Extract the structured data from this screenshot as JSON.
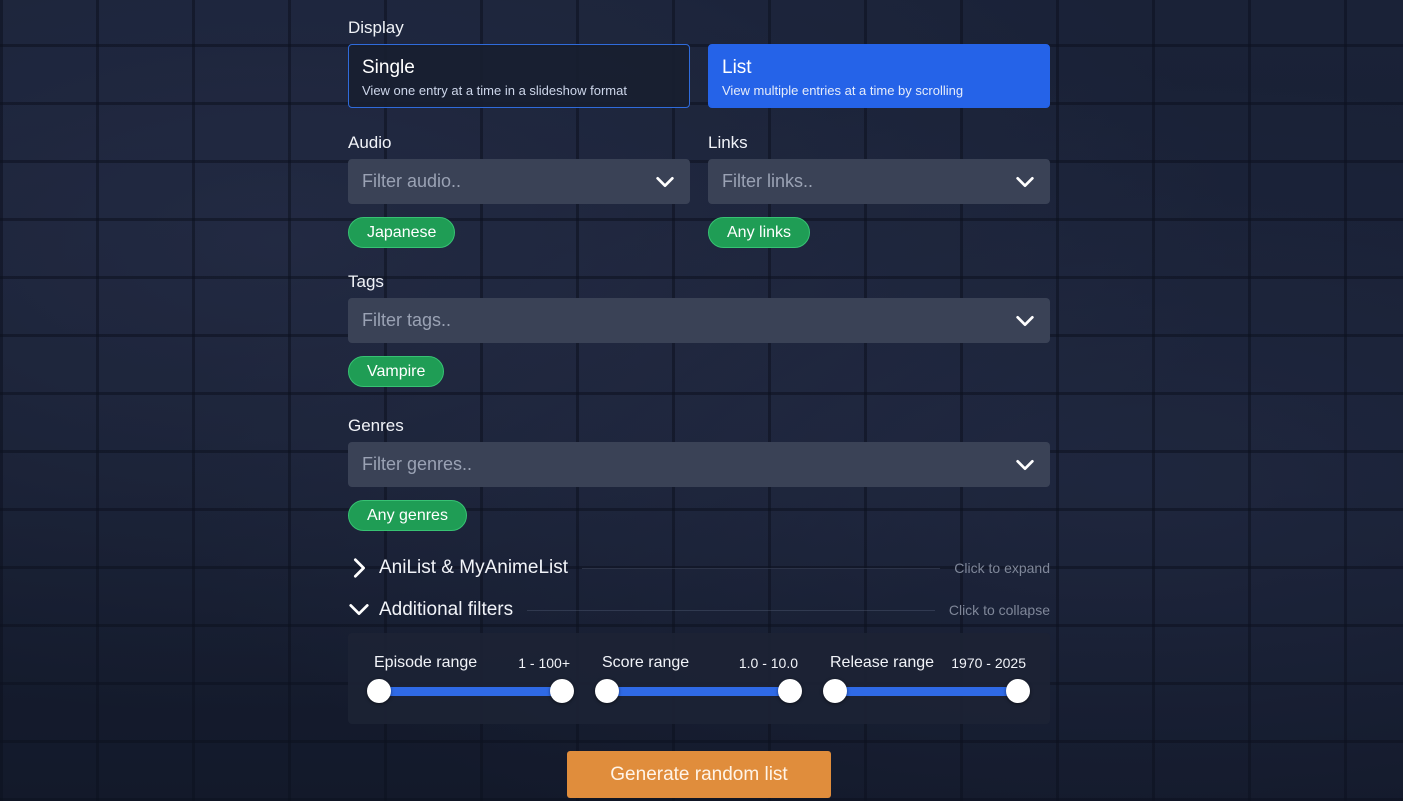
{
  "display": {
    "label": "Display",
    "options": [
      {
        "title": "Single",
        "description": "View one entry at a time in a slideshow format",
        "selected": false
      },
      {
        "title": "List",
        "description": "View multiple entries at a time by scrolling",
        "selected": true
      }
    ]
  },
  "audio": {
    "label": "Audio",
    "placeholder": "Filter audio..",
    "chip": "Japanese"
  },
  "links": {
    "label": "Links",
    "placeholder": "Filter links..",
    "chip": "Any links"
  },
  "tags": {
    "label": "Tags",
    "placeholder": "Filter tags..",
    "chip": "Vampire"
  },
  "genres": {
    "label": "Genres",
    "placeholder": "Filter genres..",
    "chip": "Any genres"
  },
  "sections": {
    "anilist": {
      "title": "AniList & MyAnimeList",
      "hint": "Click to expand",
      "icon": "chevron-right-icon"
    },
    "additional": {
      "title": "Additional filters",
      "hint": "Click to collapse",
      "icon": "chevron-down-icon"
    }
  },
  "ranges": [
    {
      "label": "Episode range",
      "value": "1 - 100+"
    },
    {
      "label": "Score range",
      "value": "1.0 - 10.0"
    },
    {
      "label": "Release range",
      "value": "1970 - 2025"
    }
  ],
  "generate_button": "Generate random list",
  "colors": {
    "accent_blue": "#2563e8",
    "chip_green": "#1f9d55",
    "generate_orange": "#e08d3c",
    "input_bg": "#3a4256"
  }
}
